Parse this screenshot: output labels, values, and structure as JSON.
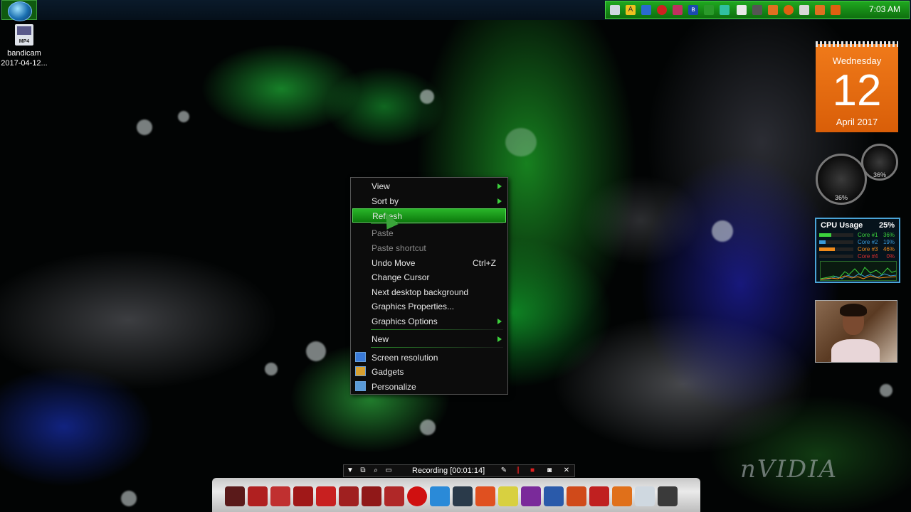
{
  "desktop": {
    "icon": {
      "label": "bandicam",
      "sublabel": "2017-04-12...",
      "ext": "MP4"
    },
    "watermark": "nVIDIA"
  },
  "taskbar": {
    "clock": "7:03 AM",
    "tray_icons": [
      "window-icon",
      "font-icon",
      "battery-icon",
      "record-icon",
      "pin-icon",
      "bluetooth-icon",
      "flag-icon",
      "network-icon",
      "hardware-icon",
      "pen-icon",
      "rocket-icon",
      "power-icon",
      "usb-icon",
      "wifi-icon",
      "volume-icon"
    ]
  },
  "calendar": {
    "day": "Wednesday",
    "date": "12",
    "month": "April 2017"
  },
  "gauges": {
    "left_value": "36%",
    "right_value": "36%"
  },
  "cpu_meter": {
    "title": "CPU Usage",
    "total": "25%",
    "cores": [
      {
        "name": "Core #1",
        "value": "36%",
        "level": 0.36,
        "color": "#3cd23c"
      },
      {
        "name": "Core #2",
        "value": "19%",
        "level": 0.19,
        "color": "#3a9ad8"
      },
      {
        "name": "Core #3",
        "value": "46%",
        "level": 0.46,
        "color": "#f08a1a"
      },
      {
        "name": "Core #4",
        "value": "0%",
        "level": 0.0,
        "color": "#e03030"
      }
    ]
  },
  "context_menu": {
    "items": [
      {
        "label": "View",
        "submenu": true
      },
      {
        "label": "Sort by",
        "submenu": true
      },
      {
        "label": "Refresh",
        "highlighted": true
      },
      {
        "label": "Paste",
        "disabled": true
      },
      {
        "label": "Paste shortcut",
        "disabled": true
      },
      {
        "label": "Undo Move",
        "shortcut": "Ctrl+Z"
      },
      {
        "label": "Change Cursor"
      },
      {
        "label": "Next desktop background"
      },
      {
        "label": "Graphics Properties..."
      },
      {
        "label": "Graphics Options",
        "submenu": true
      },
      {
        "label": "New",
        "submenu": true
      },
      {
        "label": "Screen resolution",
        "icon": "monitor-icon"
      },
      {
        "label": "Gadgets",
        "icon": "gadgets-icon"
      },
      {
        "label": "Personalize",
        "icon": "personalize-icon"
      }
    ]
  },
  "recorder": {
    "status": "Recording [00:01:14]"
  },
  "dock": {
    "items": [
      "monitor-app",
      "hdd-app-1",
      "hdd-app-2",
      "disc-app-1",
      "disc-app-2",
      "hdd-app-3",
      "hdd-app-4",
      "hdd-app-5",
      "record-app",
      "folder-app",
      "media-app",
      "tools-app",
      "paint-app",
      "onenote-app",
      "word-app",
      "powerpoint-app",
      "game-app",
      "firefox-app",
      "recycle-bin",
      "terminal-app"
    ],
    "colors": {
      "onenote-app": "#7a2a9a",
      "word-app": "#2a5aaa",
      "powerpoint-app": "#d04a1a",
      "firefox-app": "#e0701a"
    }
  },
  "colors": {
    "accent": "#1fa81f",
    "calendar": "#f07a1a",
    "menu_highlight": "#29b629"
  }
}
